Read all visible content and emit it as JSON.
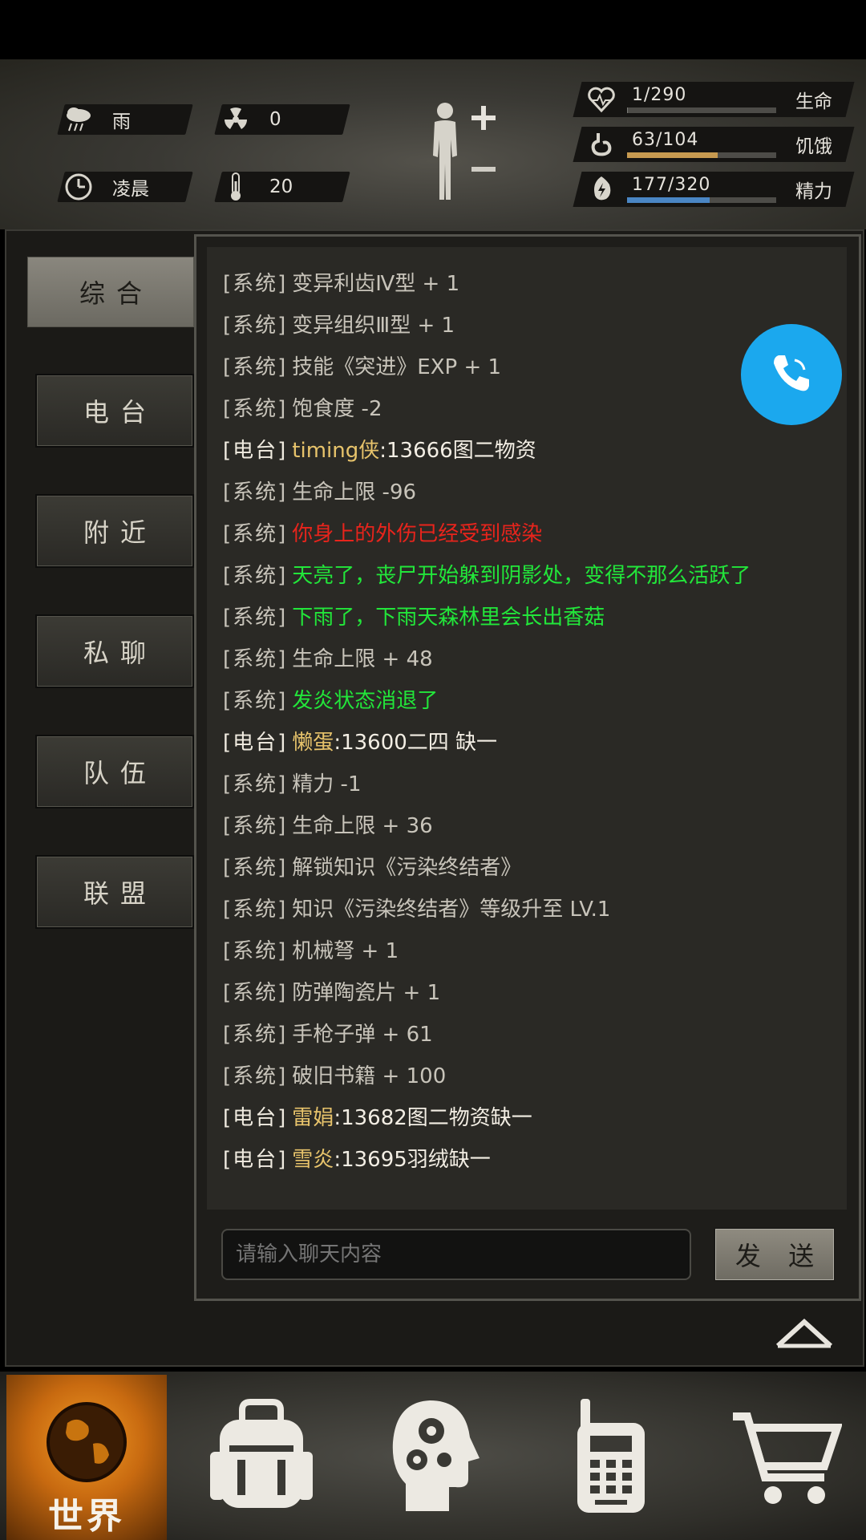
{
  "status": {
    "weather": "雨",
    "radiation": "0",
    "time_of_day": "凌晨",
    "temperature": "20",
    "health": {
      "value": "1/290",
      "label": "生命",
      "fraction": 0.0034,
      "color": "#7a7a76"
    },
    "hunger": {
      "value": "63/104",
      "label": "饥饿",
      "fraction": 0.606,
      "color": "#c79a50"
    },
    "energy": {
      "value": "177/320",
      "label": "精力",
      "fraction": 0.553,
      "color": "#4a86c4"
    }
  },
  "tabs": [
    "综合",
    "电台",
    "附近",
    "私聊",
    "队伍",
    "联盟"
  ],
  "chat": {
    "lines": [
      {
        "tag": "[系统]",
        "text": "变异利齿Ⅳ型 + 1",
        "color": "#c8c4ba"
      },
      {
        "tag": "[系统]",
        "text": "变异组织Ⅲ型 + 1",
        "color": "#c8c4ba"
      },
      {
        "tag": "[系统]",
        "text": "技能《突进》EXP + 1",
        "color": "#c8c4ba"
      },
      {
        "tag": "[系统]",
        "text": "饱食度 -2",
        "color": "#c8c4ba"
      },
      {
        "tag": "[电台]",
        "name": "timing侠",
        "text": ":13666图二物资"
      },
      {
        "tag": "[系统]",
        "text": "生命上限 -96",
        "color": "#c8c4ba"
      },
      {
        "tag": "[系统]",
        "text": "你身上的外伤已经受到感染",
        "color": "#e8241c"
      },
      {
        "tag": "[系统]",
        "text": "天亮了，丧尸开始躲到阴影处，变得不那么活跃了",
        "color": "#22e63a"
      },
      {
        "tag": "[系统]",
        "text": "下雨了，下雨天森林里会长出香菇",
        "color": "#22e63a"
      },
      {
        "tag": "[系统]",
        "text": "生命上限 + 48",
        "color": "#c8c4ba"
      },
      {
        "tag": "[系统]",
        "text": "发炎状态消退了",
        "color": "#22e63a"
      },
      {
        "tag": "[电台]",
        "name": "懒蛋",
        "text": ":13600二四 缺一"
      },
      {
        "tag": "[系统]",
        "text": "精力 -1",
        "color": "#c8c4ba"
      },
      {
        "tag": "[系统]",
        "text": "生命上限 + 36",
        "color": "#c8c4ba"
      },
      {
        "tag": "[系统]",
        "text": "解锁知识《污染终结者》",
        "color": "#c8c4ba"
      },
      {
        "tag": "[系统]",
        "text": "知识《污染终结者》等级升至 LV.1",
        "color": "#c8c4ba"
      },
      {
        "tag": "[系统]",
        "text": "机械弩 + 1",
        "color": "#c8c4ba"
      },
      {
        "tag": "[系统]",
        "text": "防弹陶瓷片 + 1",
        "color": "#c8c4ba"
      },
      {
        "tag": "[系统]",
        "text": "手枪子弹 + 61",
        "color": "#c8c4ba"
      },
      {
        "tag": "[系统]",
        "text": "破旧书籍 + 100",
        "color": "#c8c4ba"
      },
      {
        "tag": "[电台]",
        "name": "雷娟",
        "text": ":13682图二物资缺一"
      },
      {
        "tag": "[电台]",
        "name": "雪炎",
        "text": ":13695羽绒缺一"
      }
    ],
    "input_placeholder": "请输入聊天内容",
    "send_label": "发 送"
  },
  "nav": {
    "world_label": "世界",
    "icons": [
      "backpack-icon",
      "skills-head-icon",
      "radio-icon",
      "shop-cart-icon"
    ]
  },
  "call_icon": "phone-icon"
}
